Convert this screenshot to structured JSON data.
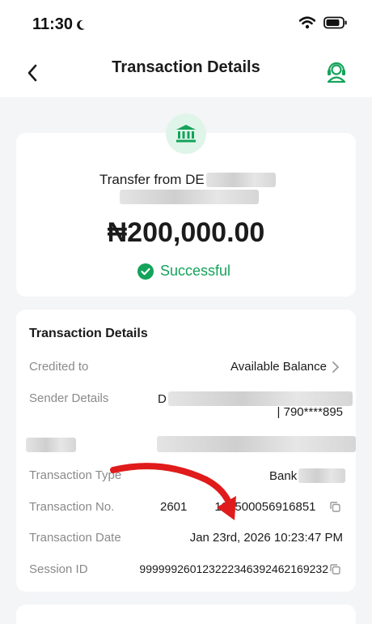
{
  "status_bar": {
    "time": "11:30"
  },
  "header": {
    "title": "Transaction Details"
  },
  "summary": {
    "sender_prefix": "Transfer from DE",
    "amount": "₦200,000.00",
    "status": "Successful"
  },
  "details": {
    "section_title": "Transaction Details",
    "credited_to": {
      "label": "Credited to",
      "value": "Available Balance"
    },
    "sender_details": {
      "label": "Sender Details",
      "value_prefix": "D",
      "account": "| 790****895"
    },
    "transaction_type": {
      "label": "Transaction Type",
      "value_prefix": "Bank"
    },
    "transaction_no": {
      "label": "Transaction No.",
      "value_start": "2601",
      "value_end": "100500056916851"
    },
    "transaction_date": {
      "label": "Transaction Date",
      "value": "Jan 23rd, 2026 10:23:47 PM"
    },
    "session_id": {
      "label": "Session ID",
      "value": "999999260123222346392462169232"
    }
  },
  "colors": {
    "accent": "#14a35a",
    "annotation_arrow": "#e01b1b"
  }
}
